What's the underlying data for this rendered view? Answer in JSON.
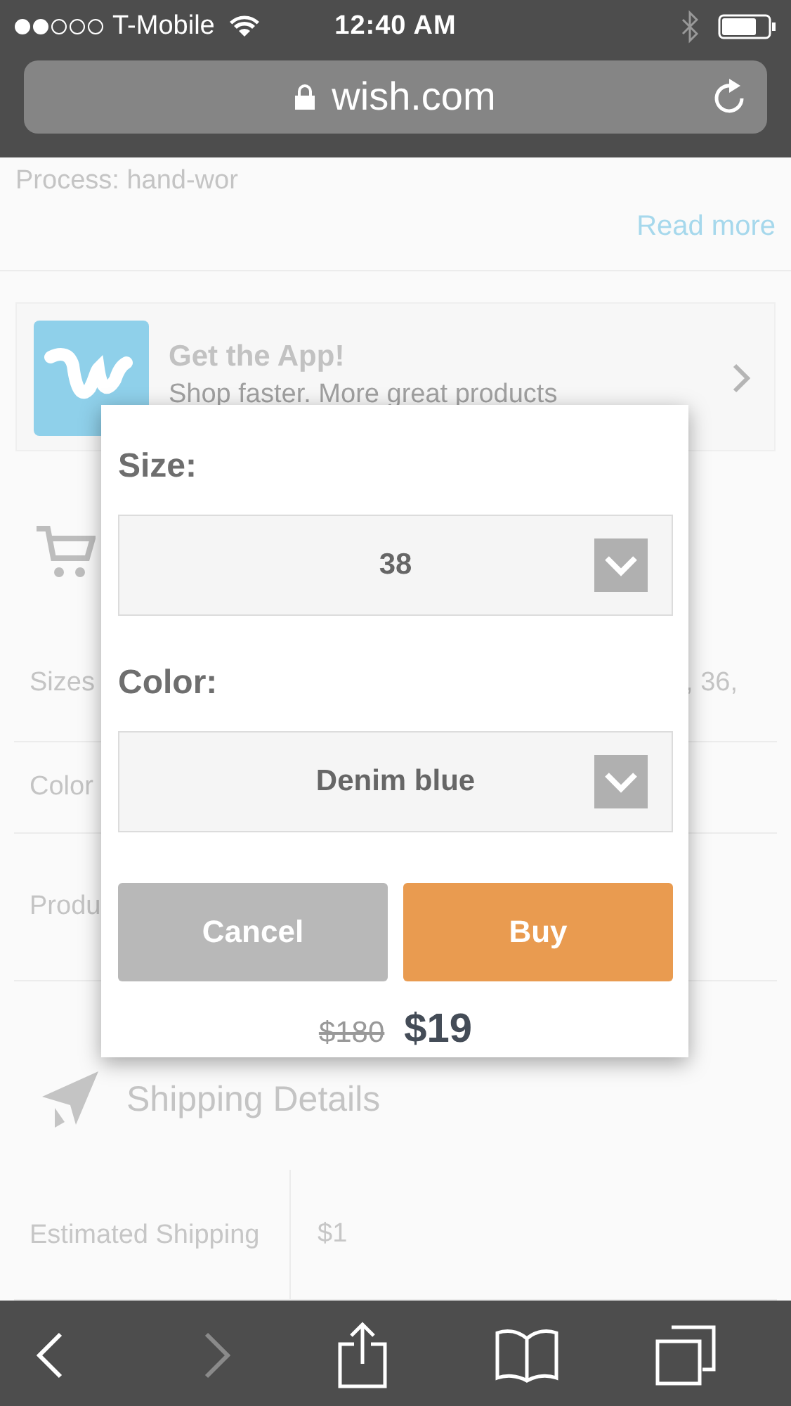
{
  "status_bar": {
    "carrier": "T-Mobile",
    "time": "12:40 AM"
  },
  "address_bar": {
    "url": "wish.com"
  },
  "page": {
    "description": "Process: hand-wor",
    "read_more": "Read more",
    "app_banner": {
      "title": "Get the App!",
      "subtitle": "Shop faster. More great products"
    },
    "attributes": [
      {
        "label": "Sizes",
        "value": ", 36,"
      },
      {
        "label": "Color"
      },
      {
        "label": "Produ"
      }
    ],
    "shipping": {
      "title": "Shipping Details",
      "rows": [
        {
          "label": "Estimated Shipping",
          "value": "$1"
        }
      ]
    }
  },
  "dialog": {
    "fields": [
      {
        "label": "Size:",
        "value": "38"
      },
      {
        "label": "Color:",
        "value": "Denim blue"
      }
    ],
    "buttons": [
      {
        "label": "Cancel",
        "kind": "secondary"
      },
      {
        "label": "Buy",
        "kind": "primary"
      }
    ],
    "price": {
      "original": "$180",
      "current": "$19"
    }
  },
  "toolbar": [
    {
      "kind": "back",
      "disabled": false
    },
    {
      "kind": "forward",
      "disabled": true
    },
    {
      "kind": "share",
      "disabled": false
    },
    {
      "kind": "bookmarks",
      "disabled": false
    },
    {
      "kind": "tabs",
      "disabled": false
    }
  ]
}
